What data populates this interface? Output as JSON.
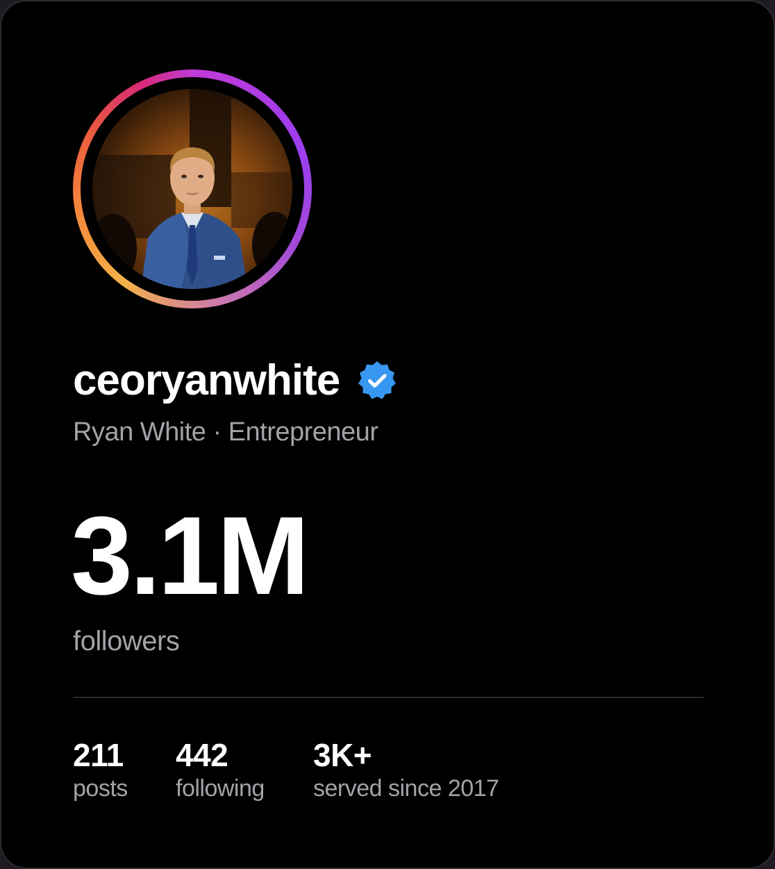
{
  "profile": {
    "username": "ceoryanwhite",
    "subtitle": "Ryan White · Entrepreneur",
    "verified_icon": "verified-badge-icon",
    "followers_count": "3.1M",
    "followers_label": "followers"
  },
  "stats": [
    {
      "value": "211",
      "label": "posts"
    },
    {
      "value": "442",
      "label": "following"
    },
    {
      "value": "3K+",
      "label": "served since 2017"
    }
  ],
  "colors": {
    "background": "#000000",
    "verified_blue": "#3897f0",
    "muted_text": "#a3a2a8",
    "ring_gradient": [
      "#f4b14a",
      "#ea5a3e",
      "#d8297a",
      "#9b3df0"
    ]
  }
}
